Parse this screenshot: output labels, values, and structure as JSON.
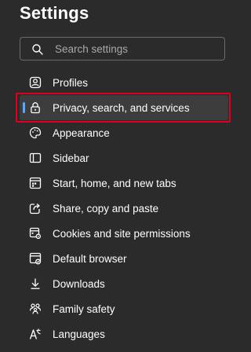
{
  "page": {
    "title": "Settings"
  },
  "search": {
    "placeholder": "Search settings",
    "icon": "search-icon"
  },
  "nav": {
    "active_index": 1,
    "items": [
      {
        "label": "Profiles",
        "icon": "profile-icon"
      },
      {
        "label": "Privacy, search, and services",
        "icon": "lock-icon"
      },
      {
        "label": "Appearance",
        "icon": "palette-icon"
      },
      {
        "label": "Sidebar",
        "icon": "sidebar-icon"
      },
      {
        "label": "Start, home, and new tabs",
        "icon": "home-tabs-icon"
      },
      {
        "label": "Share, copy and paste",
        "icon": "share-icon"
      },
      {
        "label": "Cookies and site permissions",
        "icon": "cookies-icon"
      },
      {
        "label": "Default browser",
        "icon": "browser-icon"
      },
      {
        "label": "Downloads",
        "icon": "download-icon"
      },
      {
        "label": "Family safety",
        "icon": "family-icon"
      },
      {
        "label": "Languages",
        "icon": "languages-icon"
      }
    ]
  },
  "colors": {
    "background": "#2b2b2b",
    "active_bg": "#3d3d3d",
    "accent": "#5aa7ff",
    "highlight": "#e0001b"
  }
}
